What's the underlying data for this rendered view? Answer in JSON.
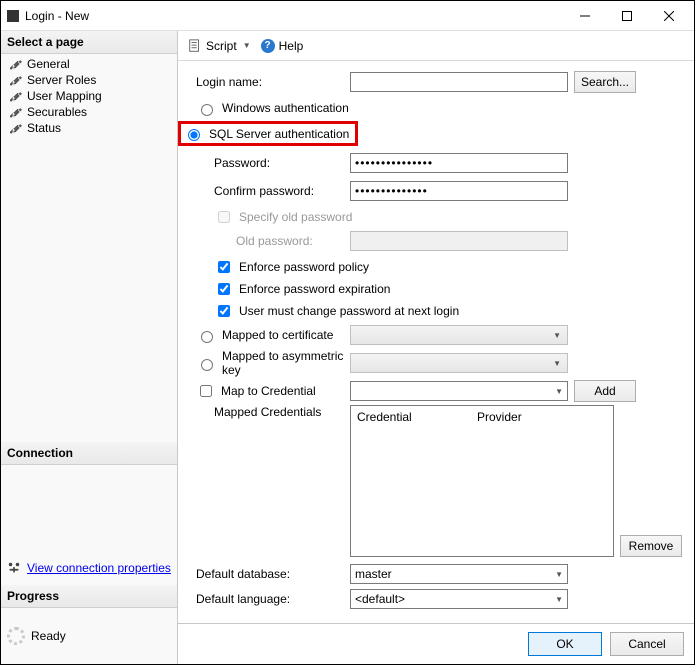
{
  "window": {
    "title": "Login - New"
  },
  "sidebar": {
    "select_page_header": "Select a page",
    "pages": [
      {
        "label": "General"
      },
      {
        "label": "Server Roles"
      },
      {
        "label": "User Mapping"
      },
      {
        "label": "Securables"
      },
      {
        "label": "Status"
      }
    ],
    "connection_header": "Connection",
    "connection_link_label": "View connection properties",
    "progress_header": "Progress",
    "progress_status": "Ready"
  },
  "toolbar": {
    "script_label": "Script",
    "help_label": "Help"
  },
  "form": {
    "login_name_label": "Login name:",
    "login_name_value": "",
    "search_button": "Search...",
    "auth_windows_label": "Windows authentication",
    "auth_sql_label": "SQL Server authentication",
    "password_label": "Password:",
    "password_value": "•••••••••••••••",
    "confirm_password_label": "Confirm password:",
    "confirm_password_value": "••••••••••••••",
    "specify_old_password_label": "Specify old password",
    "old_password_label": "Old password:",
    "enforce_policy_label": "Enforce password policy",
    "enforce_expiration_label": "Enforce password expiration",
    "must_change_label": "User must change password at next login",
    "mapped_cert_label": "Mapped to certificate",
    "mapped_asym_label": "Mapped to asymmetric key",
    "map_cred_label": "Map to Credential",
    "add_button": "Add",
    "mapped_credentials_label": "Mapped Credentials",
    "cred_col_credential": "Credential",
    "cred_col_provider": "Provider",
    "remove_button": "Remove",
    "default_database_label": "Default database:",
    "default_database_value": "master",
    "default_language_label": "Default language:",
    "default_language_value": "<default>"
  },
  "footer": {
    "ok": "OK",
    "cancel": "Cancel"
  }
}
